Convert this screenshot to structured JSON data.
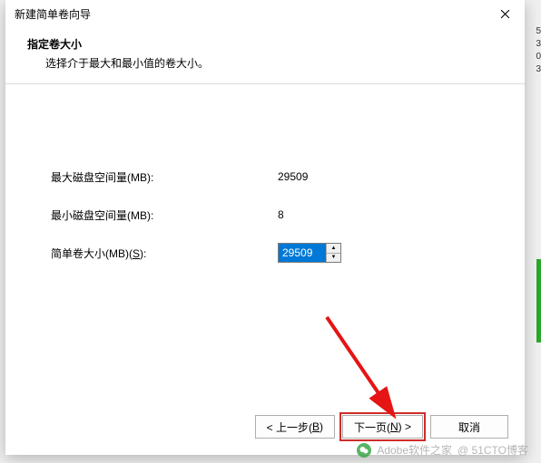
{
  "right_nums": [
    "5",
    "3",
    "0",
    "3"
  ],
  "dialog": {
    "title": "新建简单卷向导",
    "header": {
      "title": "指定卷大小",
      "subtitle": "选择介于最大和最小值的卷大小。"
    },
    "fields": {
      "max_label": "最大磁盘空间量(MB):",
      "max_value": "29509",
      "min_label": "最小磁盘空间量(MB):",
      "min_value": "8",
      "size_label_a": "简单卷大小(MB)(",
      "size_label_u": "S",
      "size_label_b": "):",
      "size_value": "29509"
    },
    "buttons": {
      "back_a": "< 上一步(",
      "back_u": "B",
      "back_b": ")",
      "next_a": "下一页(",
      "next_u": "N",
      "next_b": ") >",
      "cancel": "取消"
    }
  },
  "watermark": {
    "left": "Adobe软件之家",
    "right": "@ 51CTO博客"
  }
}
